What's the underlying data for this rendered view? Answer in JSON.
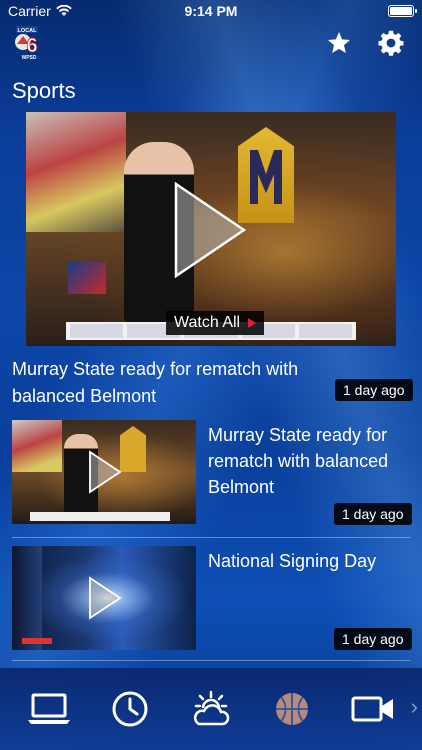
{
  "status_bar": {
    "carrier": "Carrier",
    "time": "9:14 PM"
  },
  "header": {
    "title": "Sports",
    "logo_text": "LOCAL 6 WPSD",
    "actions": [
      "star-icon",
      "gear-icon"
    ]
  },
  "hero": {
    "watch_all_label": "Watch All",
    "title": "Murray State ready for rematch with balanced Belmont",
    "time_ago": "1 day ago"
  },
  "items": [
    {
      "title": "Murray State ready for rematch with balanced Belmont",
      "time_ago": "1 day ago"
    },
    {
      "title": "National Signing Day",
      "time_ago": "1 day ago"
    }
  ],
  "tab_bar": {
    "tabs": [
      "laptop-icon",
      "clock-icon",
      "weather-icon",
      "basketball-icon",
      "video-camera-icon"
    ],
    "active_tab": "basketball-icon"
  },
  "colors": {
    "accent_red": "#e0203a",
    "background_blue": "#0c47a8",
    "inactive_tab": "#f0a878"
  }
}
